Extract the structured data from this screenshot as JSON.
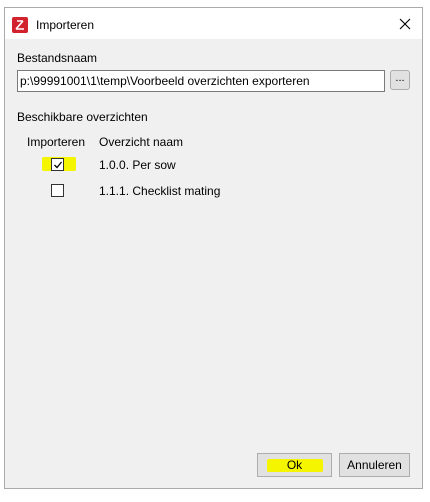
{
  "window": {
    "title": "Importeren",
    "close_glyph": "×"
  },
  "file": {
    "label": "Bestandsnaam",
    "path_value": "p:\\99991001\\1\\temp\\Voorbeeld overzichten exporteren",
    "browse_label": "..."
  },
  "overviews": {
    "label": "Beschikbare overzichten",
    "columns": {
      "import": "Importeren",
      "name": "Overzicht naam"
    },
    "rows": [
      {
        "checked": true,
        "name": "1.0.0. Per sow"
      },
      {
        "checked": false,
        "name": "1.1.1. Checklist mating"
      }
    ]
  },
  "buttons": {
    "ok": "Ok",
    "cancel": "Annuleren"
  },
  "colors": {
    "accent": "#d2222d",
    "highlight": "#f5f500"
  }
}
